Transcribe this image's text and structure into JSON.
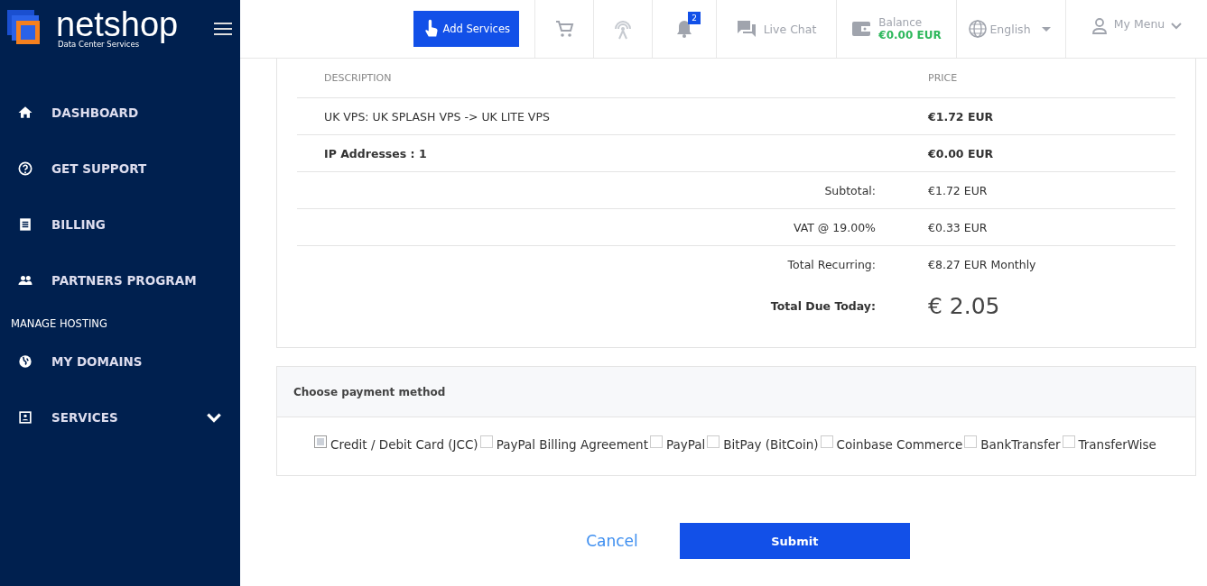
{
  "brand": {
    "name": "netshop",
    "tagline": "Data Center Services"
  },
  "sidebar": {
    "entries": [
      {
        "kind": "item",
        "label": "DASHBOARD"
      },
      {
        "kind": "item",
        "label": "GET SUPPORT"
      },
      {
        "kind": "item",
        "label": "BILLING"
      },
      {
        "kind": "item",
        "label": "PARTNERS PROGRAM"
      },
      {
        "kind": "heading",
        "label": "MANAGE HOSTING"
      },
      {
        "kind": "item",
        "label": "MY DOMAINS"
      },
      {
        "kind": "submenu",
        "label": "SERVICES",
        "expanded": false
      }
    ]
  },
  "header": {
    "add_button": "Add Services",
    "notifications_count": "2",
    "live_chat": "Live Chat",
    "balance_label": "Balance",
    "balance_value": "€0.00 EUR",
    "language": "English",
    "user_menu": "My Menu"
  },
  "invoice": {
    "columns": [
      "DESCRIPTION",
      "PRICE"
    ],
    "items": [
      {
        "description": "UK VPS: UK SPLASH VPS -> UK LITE VPS",
        "price": "€1.72 EUR",
        "bold_description": false
      },
      {
        "description": "IP Addresses : 1",
        "price": "€0.00 EUR",
        "bold_description": true
      }
    ],
    "totals": [
      {
        "label": "Subtotal:",
        "value": "€1.72 EUR"
      },
      {
        "label": "VAT @ 19.00%",
        "value": "€0.33 EUR"
      },
      {
        "label": "Total Recurring:",
        "value": "€8.27 EUR Monthly"
      }
    ],
    "total_due": {
      "label": "Total Due Today:",
      "value": "€ 2.05"
    }
  },
  "payment": {
    "title": "Choose payment method",
    "options": [
      {
        "label": "Credit / Debit Card (JCC)",
        "selected": true
      },
      {
        "label": "PayPal Billing Agreement",
        "selected": false
      },
      {
        "label": "PayPal",
        "selected": false
      },
      {
        "label": "BitPay (BitCoin)",
        "selected": false
      },
      {
        "label": "Coinbase Commerce",
        "selected": false
      },
      {
        "label": "BankTransfer",
        "selected": false
      },
      {
        "label": "TransferWise",
        "selected": false
      }
    ]
  },
  "actions": {
    "cancel": "Cancel",
    "submit": "Submit"
  }
}
